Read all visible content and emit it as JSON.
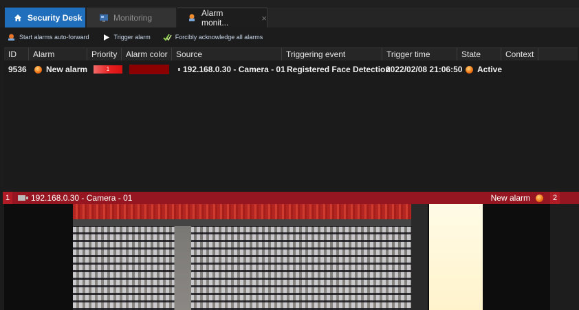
{
  "tabs": {
    "home": {
      "label": "Security Desk",
      "icon": "home-icon"
    },
    "monitoring": {
      "label": "Monitoring",
      "icon": "monitoring-icon"
    },
    "alarm": {
      "label": "Alarm monit...",
      "icon": "alarm-monitoring-icon",
      "close": "×"
    }
  },
  "toolbar": {
    "auto_forward": {
      "label": "Start alarms auto-forward",
      "icon": "auto-forward-icon"
    },
    "trigger": {
      "label": "Trigger alarm",
      "icon": "play-icon"
    },
    "ack_all": {
      "label": "Forcibly acknowledge all alarms",
      "icon": "checkmark-icon"
    }
  },
  "table": {
    "columns": [
      "ID",
      "Alarm",
      "Priority",
      "Alarm color",
      "Source",
      "Triggering event",
      "Trigger time",
      "State",
      "Context"
    ],
    "rows": [
      {
        "id": "9536",
        "alarm": "New alarm",
        "priority": "1",
        "alarm_color": "#8b0000",
        "source": "192.168.0.30 - Camera - 01",
        "event": "Registered Face Detection",
        "time": "2022/02/08 21:06:50",
        "state": "Active",
        "context": ""
      }
    ]
  },
  "video": {
    "tile_number": "1",
    "camera": "192.168.0.30 - Camera - 01",
    "alarm_label": "New alarm",
    "next_tile_number": "2"
  },
  "colors": {
    "accent": "#1f6fbd",
    "alarm_red": "#951620",
    "priority_red": "#e82020"
  }
}
